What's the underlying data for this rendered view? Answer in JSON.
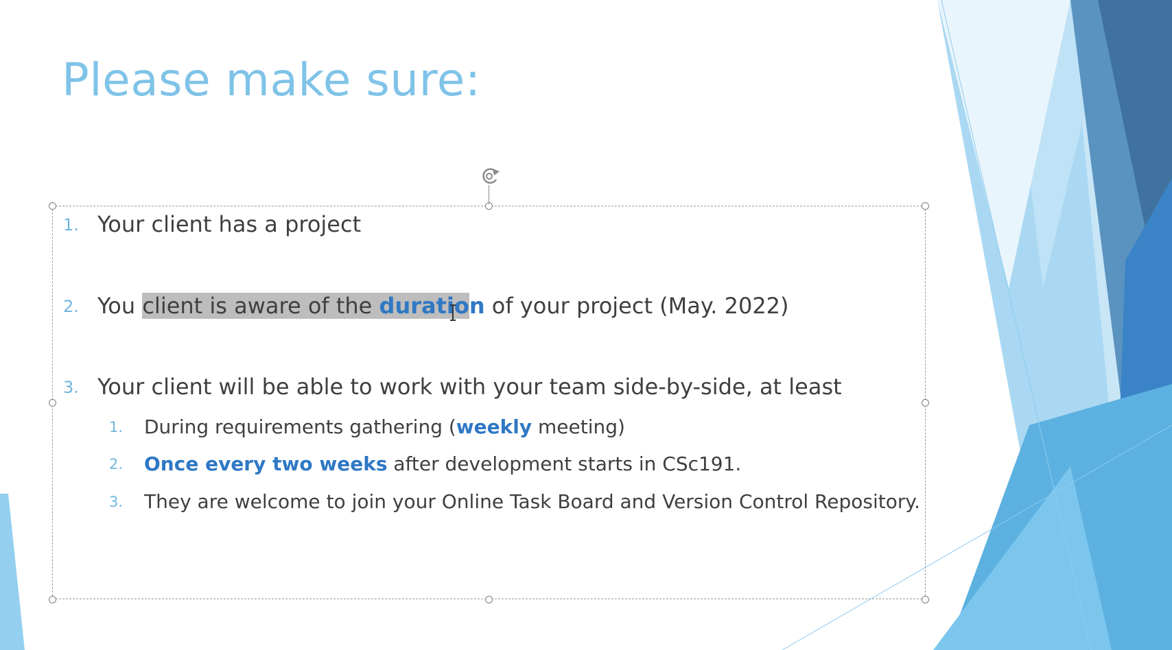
{
  "slide": {
    "title": "Please make sure:",
    "items": [
      {
        "number": "1.",
        "text": "Your client has a project"
      },
      {
        "number": "2.",
        "pre": "You ",
        "highlight_pre": "client is aware of the ",
        "highlight_em": "duratio",
        "em_tail": "n",
        "post": " of your project (May. 2022)"
      },
      {
        "number": "3.",
        "text": "Your client will be able to work with your team side-by-side, at least",
        "subitems": [
          {
            "number": "1.",
            "pre": "During requirements gathering (",
            "em": "weekly",
            "post": " meeting)"
          },
          {
            "number": "2.",
            "em": "Once every two weeks",
            "post": " after development starts in CSc191."
          },
          {
            "number": "3.",
            "text": "They are welcome to join your Online Task Board and Version Control Repository."
          }
        ]
      }
    ]
  },
  "theme": {
    "title_color": "#7fc3e8",
    "number_color": "#71b6dd",
    "emphasis_color": "#2f78c4",
    "body_text_color": "#3f3f3f",
    "selection_color": "#bdbdbd"
  },
  "icons": [
    "rotate-handle-icon",
    "text-cursor-icon"
  ]
}
